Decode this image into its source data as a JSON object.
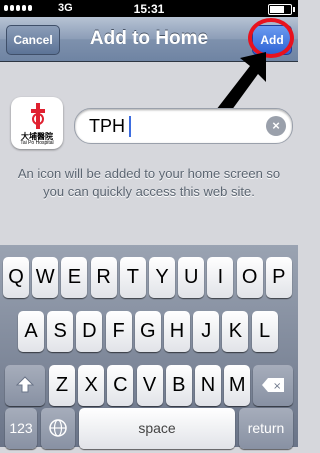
{
  "status_bar": {
    "network": "3G",
    "time": "15:31",
    "battery_level": 0.7
  },
  "nav": {
    "title": "Add to Home",
    "cancel_label": "Cancel",
    "add_label": "Add"
  },
  "app_icon": {
    "name_cn": "大埔醫院",
    "name_en": "Tai Po Hospital",
    "accent_color": "#e02030"
  },
  "name_field": {
    "value": "TPH",
    "clear_icon": "clear-icon"
  },
  "hint_text": "An icon will be added to your home screen so you can quickly access this web site.",
  "annotation": {
    "ring_color": "#e8121e",
    "arrow_color": "#000000"
  },
  "keyboard": {
    "row1": [
      "Q",
      "W",
      "E",
      "R",
      "T",
      "Y",
      "U",
      "I",
      "O",
      "P"
    ],
    "row2": [
      "A",
      "S",
      "D",
      "F",
      "G",
      "H",
      "J",
      "K",
      "L"
    ],
    "row3": [
      "Z",
      "X",
      "C",
      "V",
      "B",
      "N",
      "M"
    ],
    "shift_icon": "shift-arrow-icon",
    "backspace_icon": "backspace-icon",
    "numbers_label": "123",
    "globe_icon": "globe-icon",
    "space_label": "space",
    "return_label": "return"
  }
}
